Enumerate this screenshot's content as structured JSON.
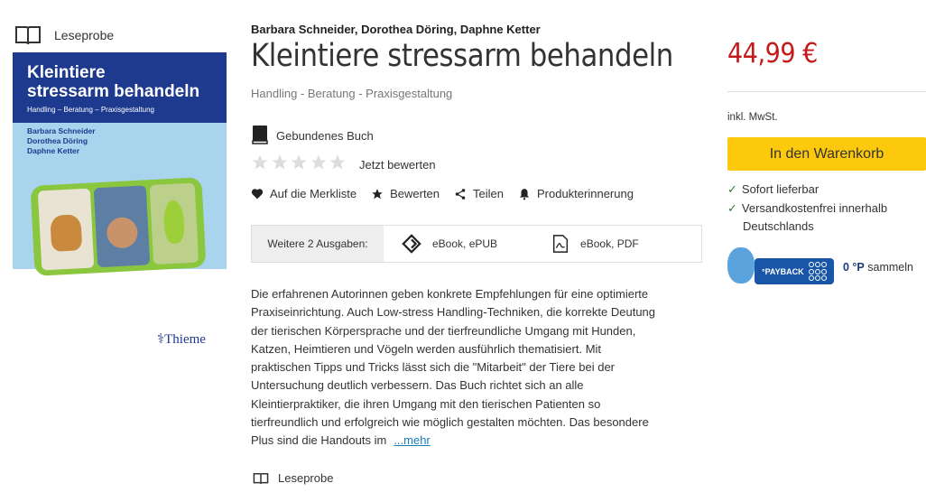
{
  "left": {
    "preview_label": "Leseprobe",
    "cover": {
      "title_line1": "Kleintiere",
      "title_line2": "stressarm behandeln",
      "subtitle": "Handling – Beratung – Praxisgestaltung",
      "authors": [
        "Barbara Schneider",
        "Dorothea Döring",
        "Daphne Ketter"
      ],
      "publisher": "Thieme"
    }
  },
  "product": {
    "authors": "Barbara Schneider, Dorothea Döring, Daphne Ketter",
    "title": "Kleintiere stressarm behandeln",
    "subtitle": "Handling - Beratung - Praxisgestaltung",
    "format": "Gebundenes Buch",
    "rating_cta": "Jetzt bewerten",
    "actions": {
      "wishlist": "Auf die Merkliste",
      "rate": "Bewerten",
      "share": "Teilen",
      "reminder": "Produkterinnerung"
    },
    "editions": {
      "label": "Weitere 2 Ausgaben:",
      "items": [
        "eBook, ePUB",
        "eBook, PDF"
      ]
    },
    "description_lines": [
      "Die erfahrenen Autorinnen geben konkrete Empfehlungen für eine optimierte",
      "Praxiseinrichtung. Auch Low-stress Handling-Techniken, die korrekte Deutung",
      "der tierischen Körpersprache und der tierfreundliche Umgang mit Hunden,",
      "Katzen, Heimtieren und Vögeln werden ausführlich thematisiert. Mit",
      "praktischen Tipps und Tricks lässt sich die \"Mitarbeit\" der Tiere bei der",
      "Untersuchung deutlich verbessern. Das Buch richtet sich an alle",
      "Kleintierpraktiker, die ihren Umgang mit den tierischen Patienten so",
      "tierfreundlich und erfolgreich wie möglich gestalten möchten. Das besondere",
      "Plus sind die Handouts im"
    ],
    "more_link": "...mehr",
    "bottom_preview": "Leseprobe"
  },
  "buybox": {
    "price": "44,99 €",
    "vat": "inkl. MwSt.",
    "cart_button": "In den Warenkorb",
    "checks": [
      "Sofort lieferbar",
      "Versandkostenfrei innerhalb",
      "Deutschlands"
    ],
    "payback_brand": "°PAYBACK",
    "payback_points": "0 °P",
    "payback_suffix": " sammeln"
  },
  "colors": {
    "price_red": "#c51a1b",
    "cart_yellow": "#fcc90d",
    "link_blue": "#1a7db8",
    "cover_blue": "#1d3a8f"
  }
}
